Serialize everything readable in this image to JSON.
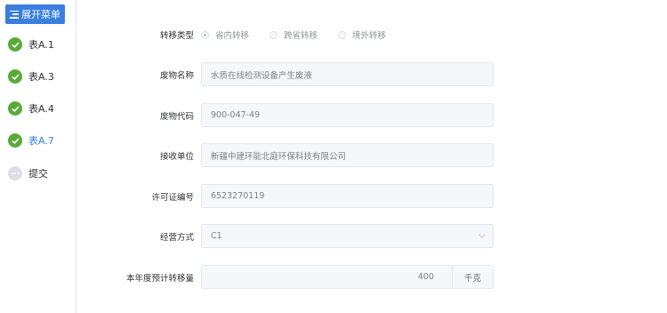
{
  "sidebar": {
    "expand_label": "展开菜单",
    "steps": [
      {
        "label": "表A.1",
        "status": "done"
      },
      {
        "label": "表A.3",
        "status": "done"
      },
      {
        "label": "表A.4",
        "status": "done"
      },
      {
        "label": "表A.7",
        "status": "active"
      },
      {
        "label": "提交",
        "status": "pending"
      }
    ]
  },
  "form": {
    "transfer_type": {
      "label": "转移类型",
      "options": [
        "省内转移",
        "跨省转移",
        "境外转移"
      ],
      "selected": "省内转移"
    },
    "waste_name": {
      "label": "废物名称",
      "value": "水质在线检测设备产生废液"
    },
    "waste_code": {
      "label": "废物代码",
      "value": "900-047-49"
    },
    "receiver": {
      "label": "接收单位",
      "value": "新疆中建环能北庭环保科技有限公司"
    },
    "license_no": {
      "label": "许可证编号",
      "value": "6523270119"
    },
    "operation_mode": {
      "label": "经营方式",
      "value": "C1"
    },
    "annual_amount": {
      "label": "本年度预计转移量",
      "value": "400",
      "unit": "千克"
    }
  },
  "colors": {
    "accent": "#3a7ee0",
    "done": "#5aaa3c",
    "pending": "#dcdfe6"
  }
}
